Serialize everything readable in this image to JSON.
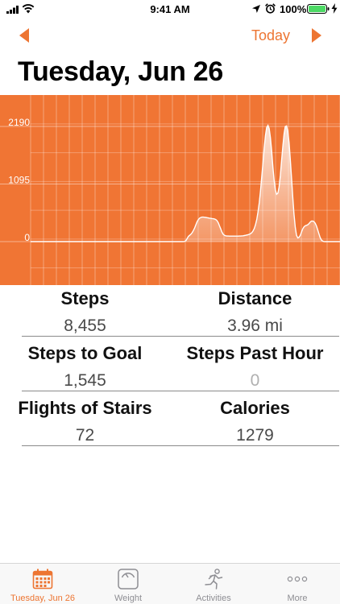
{
  "status_bar": {
    "time": "9:41 AM",
    "battery_percent": "100%",
    "battery_level": 1.0,
    "icons": [
      "cellular-signal-icon",
      "wifi-icon",
      "location-arrow-icon",
      "alarm-clock-icon",
      "battery-icon",
      "charging-bolt-icon"
    ]
  },
  "nav": {
    "today_label": "Today",
    "prev_icon": "chevron-left-icon",
    "next_icon": "chevron-right-icon"
  },
  "header": {
    "title": "Tuesday, Jun 26"
  },
  "colors": {
    "accent": "#ED7532",
    "chart_background": "#F07534",
    "inactive_tab": "#8E8E93"
  },
  "chart_data": {
    "type": "area",
    "title": "",
    "xlabel": "",
    "ylabel": "",
    "y_tick_labels": [
      "2190",
      "1095",
      "0"
    ],
    "ylim": [
      -500,
      2500
    ],
    "grid": true,
    "series": [
      {
        "values": [
          0,
          0,
          0,
          0,
          0,
          0,
          0,
          0,
          0,
          0,
          0,
          0,
          0,
          0,
          0,
          0,
          0,
          0,
          0,
          0,
          0,
          0,
          0,
          0,
          0,
          0,
          0,
          0,
          0,
          0,
          0,
          0,
          0,
          0,
          0,
          0,
          0,
          0,
          0,
          0,
          0,
          0,
          0,
          0,
          0,
          0,
          0,
          0,
          0,
          0,
          0,
          0,
          0,
          0,
          0,
          0,
          0,
          0,
          0,
          0,
          0,
          0,
          0,
          0,
          0,
          0,
          0,
          0,
          0,
          0,
          0,
          0,
          0,
          0,
          0,
          0,
          0,
          0,
          0,
          0,
          0,
          0,
          0,
          0,
          0,
          0,
          0,
          0,
          0,
          0,
          0,
          0,
          0,
          0,
          0,
          0,
          0,
          0,
          0,
          0,
          0,
          0,
          0,
          0,
          0,
          0,
          0,
          0,
          0,
          0,
          0,
          0,
          0,
          0,
          0,
          0,
          0,
          0,
          0,
          0,
          0,
          0,
          0,
          0,
          5,
          20,
          60,
          100,
          120,
          140,
          170,
          210,
          260,
          320,
          380,
          420,
          445,
          460,
          466,
          466,
          463,
          460,
          455,
          450,
          446,
          442,
          438,
          435,
          430,
          420,
          400,
          360,
          300,
          240,
          180,
          140,
          120,
          110,
          106,
          105,
          104,
          104,
          104,
          104,
          104,
          104,
          104,
          104,
          105,
          106,
          108,
          110,
          115,
          120,
          126,
          132,
          140,
          150,
          170,
          200,
          250,
          320,
          420,
          560,
          740,
          960,
          1220,
          1500,
          1780,
          2020,
          2170,
          2210,
          2150,
          1980,
          1720,
          1420,
          1160,
          980,
          900,
          920,
          1040,
          1260,
          1540,
          1820,
          2050,
          2190,
          2200,
          2100,
          1880,
          1560,
          1200,
          840,
          520,
          270,
          120,
          70,
          80,
          120,
          180,
          240,
          280,
          300,
          310,
          320,
          340,
          370,
          390,
          392,
          380,
          350,
          300,
          230,
          150,
          80,
          30,
          10,
          2,
          0,
          0,
          0,
          0,
          0,
          0,
          0,
          0,
          0,
          0,
          0,
          0,
          0
        ]
      }
    ]
  },
  "stats": {
    "steps": {
      "label": "Steps",
      "value": "8,455"
    },
    "distance": {
      "label": "Distance",
      "value": "3.96 mi"
    },
    "steps_to_goal": {
      "label": "Steps to Goal",
      "value": "1,545"
    },
    "steps_past_hour": {
      "label": "Steps Past Hour",
      "value": "0"
    },
    "flights": {
      "label": "Flights of Stairs",
      "value": "72"
    },
    "calories": {
      "label": "Calories",
      "value": "1279"
    }
  },
  "tabs": [
    {
      "label": "Tuesday, Jun 26",
      "icon": "calendar-icon",
      "active": true
    },
    {
      "label": "Weight",
      "icon": "scale-icon",
      "active": false
    },
    {
      "label": "Activities",
      "icon": "running-person-icon",
      "active": false
    },
    {
      "label": "More",
      "icon": "more-dots-icon",
      "active": false
    }
  ]
}
